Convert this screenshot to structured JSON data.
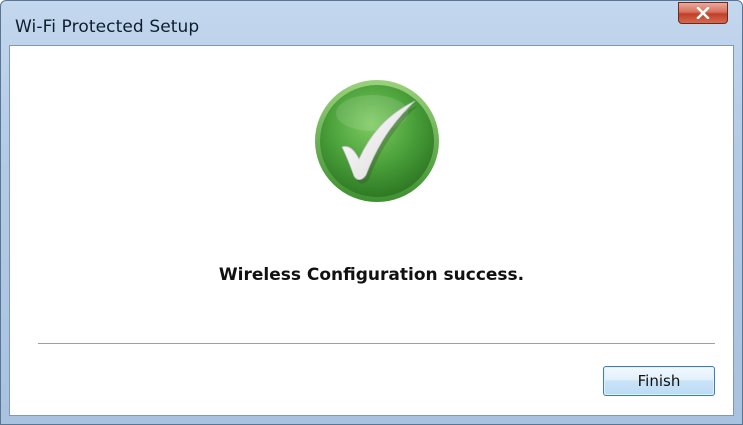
{
  "window": {
    "title": "Wi-Fi Protected Setup",
    "close_icon": "close-icon"
  },
  "content": {
    "status_icon": "checkmark-success-icon",
    "message": "Wireless Configuration success."
  },
  "footer": {
    "finish_label": "Finish"
  },
  "colors": {
    "success_green": "#4ca23b",
    "close_red": "#c0402a",
    "button_border": "#3c7fb1"
  }
}
